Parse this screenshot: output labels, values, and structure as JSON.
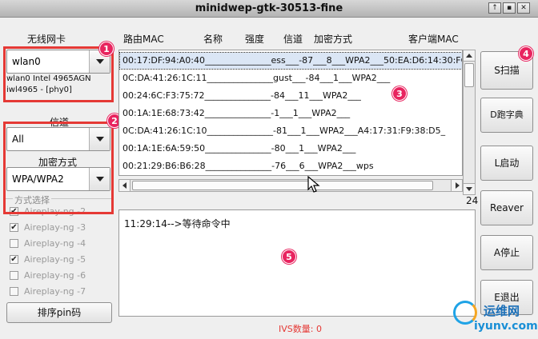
{
  "window": {
    "title": "minidwep-gtk-30513-fine",
    "controls": [
      "↑",
      "▪",
      "✕"
    ]
  },
  "left_panel": {
    "wireless_card_label": "无线网卡",
    "interface_value": "wlan0",
    "interface_info_1": "wlan0 Intel 4965AGN",
    "interface_info_2": "iwl4965 - [phy0]",
    "channel_label": "信道",
    "channel_value": "All",
    "encryption_label": "加密方式",
    "encryption_value": "WPA/WPA2",
    "mode_select_label": "方式选择",
    "aireplay_options": [
      {
        "label": "Aireplay-ng -2",
        "checked": true
      },
      {
        "label": "Aireplay-ng -3",
        "checked": true
      },
      {
        "label": "Aireplay-ng -4",
        "checked": false
      },
      {
        "label": "Aireplay-ng -5",
        "checked": true
      },
      {
        "label": "Aireplay-ng -6",
        "checked": false
      },
      {
        "label": "Aireplay-ng -7",
        "checked": false
      }
    ],
    "sort_pin_button": "排序pin码"
  },
  "table": {
    "headers": [
      "路由MAC",
      "名称",
      "强度",
      "信道",
      "加密方式",
      "客户端MAC"
    ],
    "rows": [
      "00:17:DF:94:A0:40_______________ess___-87___8___WPA2___50:EA:D6:14:30:FC",
      "0C:DA:41:26:1C:11_______________gust___-84___1___WPA2___",
      "00:24:6C:F3:75:72_______________-84___11___WPA2___",
      "00:1A:1E:68:73:42_______________-1___1___WPA2___",
      "0C:DA:41:26:1C:10_______________-81___1___WPA2___A4:17:31:F9:38:D5_",
      "00:1A:1E:6A:59:50_______________-80___1___WPA2___",
      "00:21:29:B6:B6:28_______________-76___6___WPA2___wps"
    ],
    "selected_row": 0,
    "count": "24"
  },
  "buttons": {
    "scan": "S扫描",
    "dict": "D跑字典",
    "start": "L启动",
    "reaver": "Reaver",
    "stop": "A停止",
    "exit": "E退出"
  },
  "log": {
    "line": "11:29:14-->等待命令中"
  },
  "status": {
    "ivs": "IVS数量: 0"
  },
  "annotations": [
    "1",
    "2",
    "3",
    "4",
    "5"
  ],
  "watermark": {
    "cn": "运维网",
    "en": "iyunv.com"
  },
  "colors": {
    "annotation_red": "#e53935",
    "badge_pink": "#e8245f",
    "ivs_red": "#e53935",
    "selection_bg": "#dbe6f5"
  }
}
